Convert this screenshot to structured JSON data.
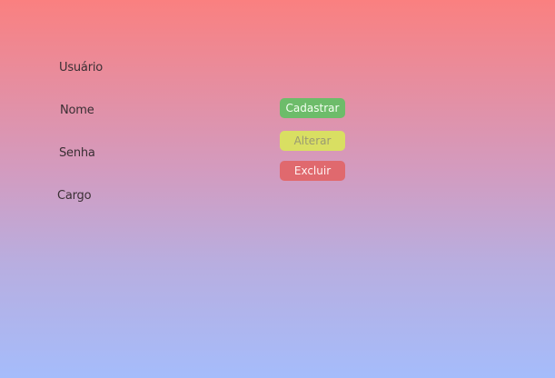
{
  "form": {
    "labels": {
      "usuario": "Usuário",
      "nome": "Nome",
      "senha": "Senha",
      "cargo": "Cargo"
    }
  },
  "actions": {
    "cadastrar": "Cadastrar",
    "alterar": "Alterar",
    "excluir": "Excluir"
  },
  "colors": {
    "background_top": "#fa8080",
    "background_bottom": "#a5bcfb",
    "cadastrar": "#6dbc6a",
    "alterar": "#d9df62",
    "excluir": "#e0696e"
  }
}
